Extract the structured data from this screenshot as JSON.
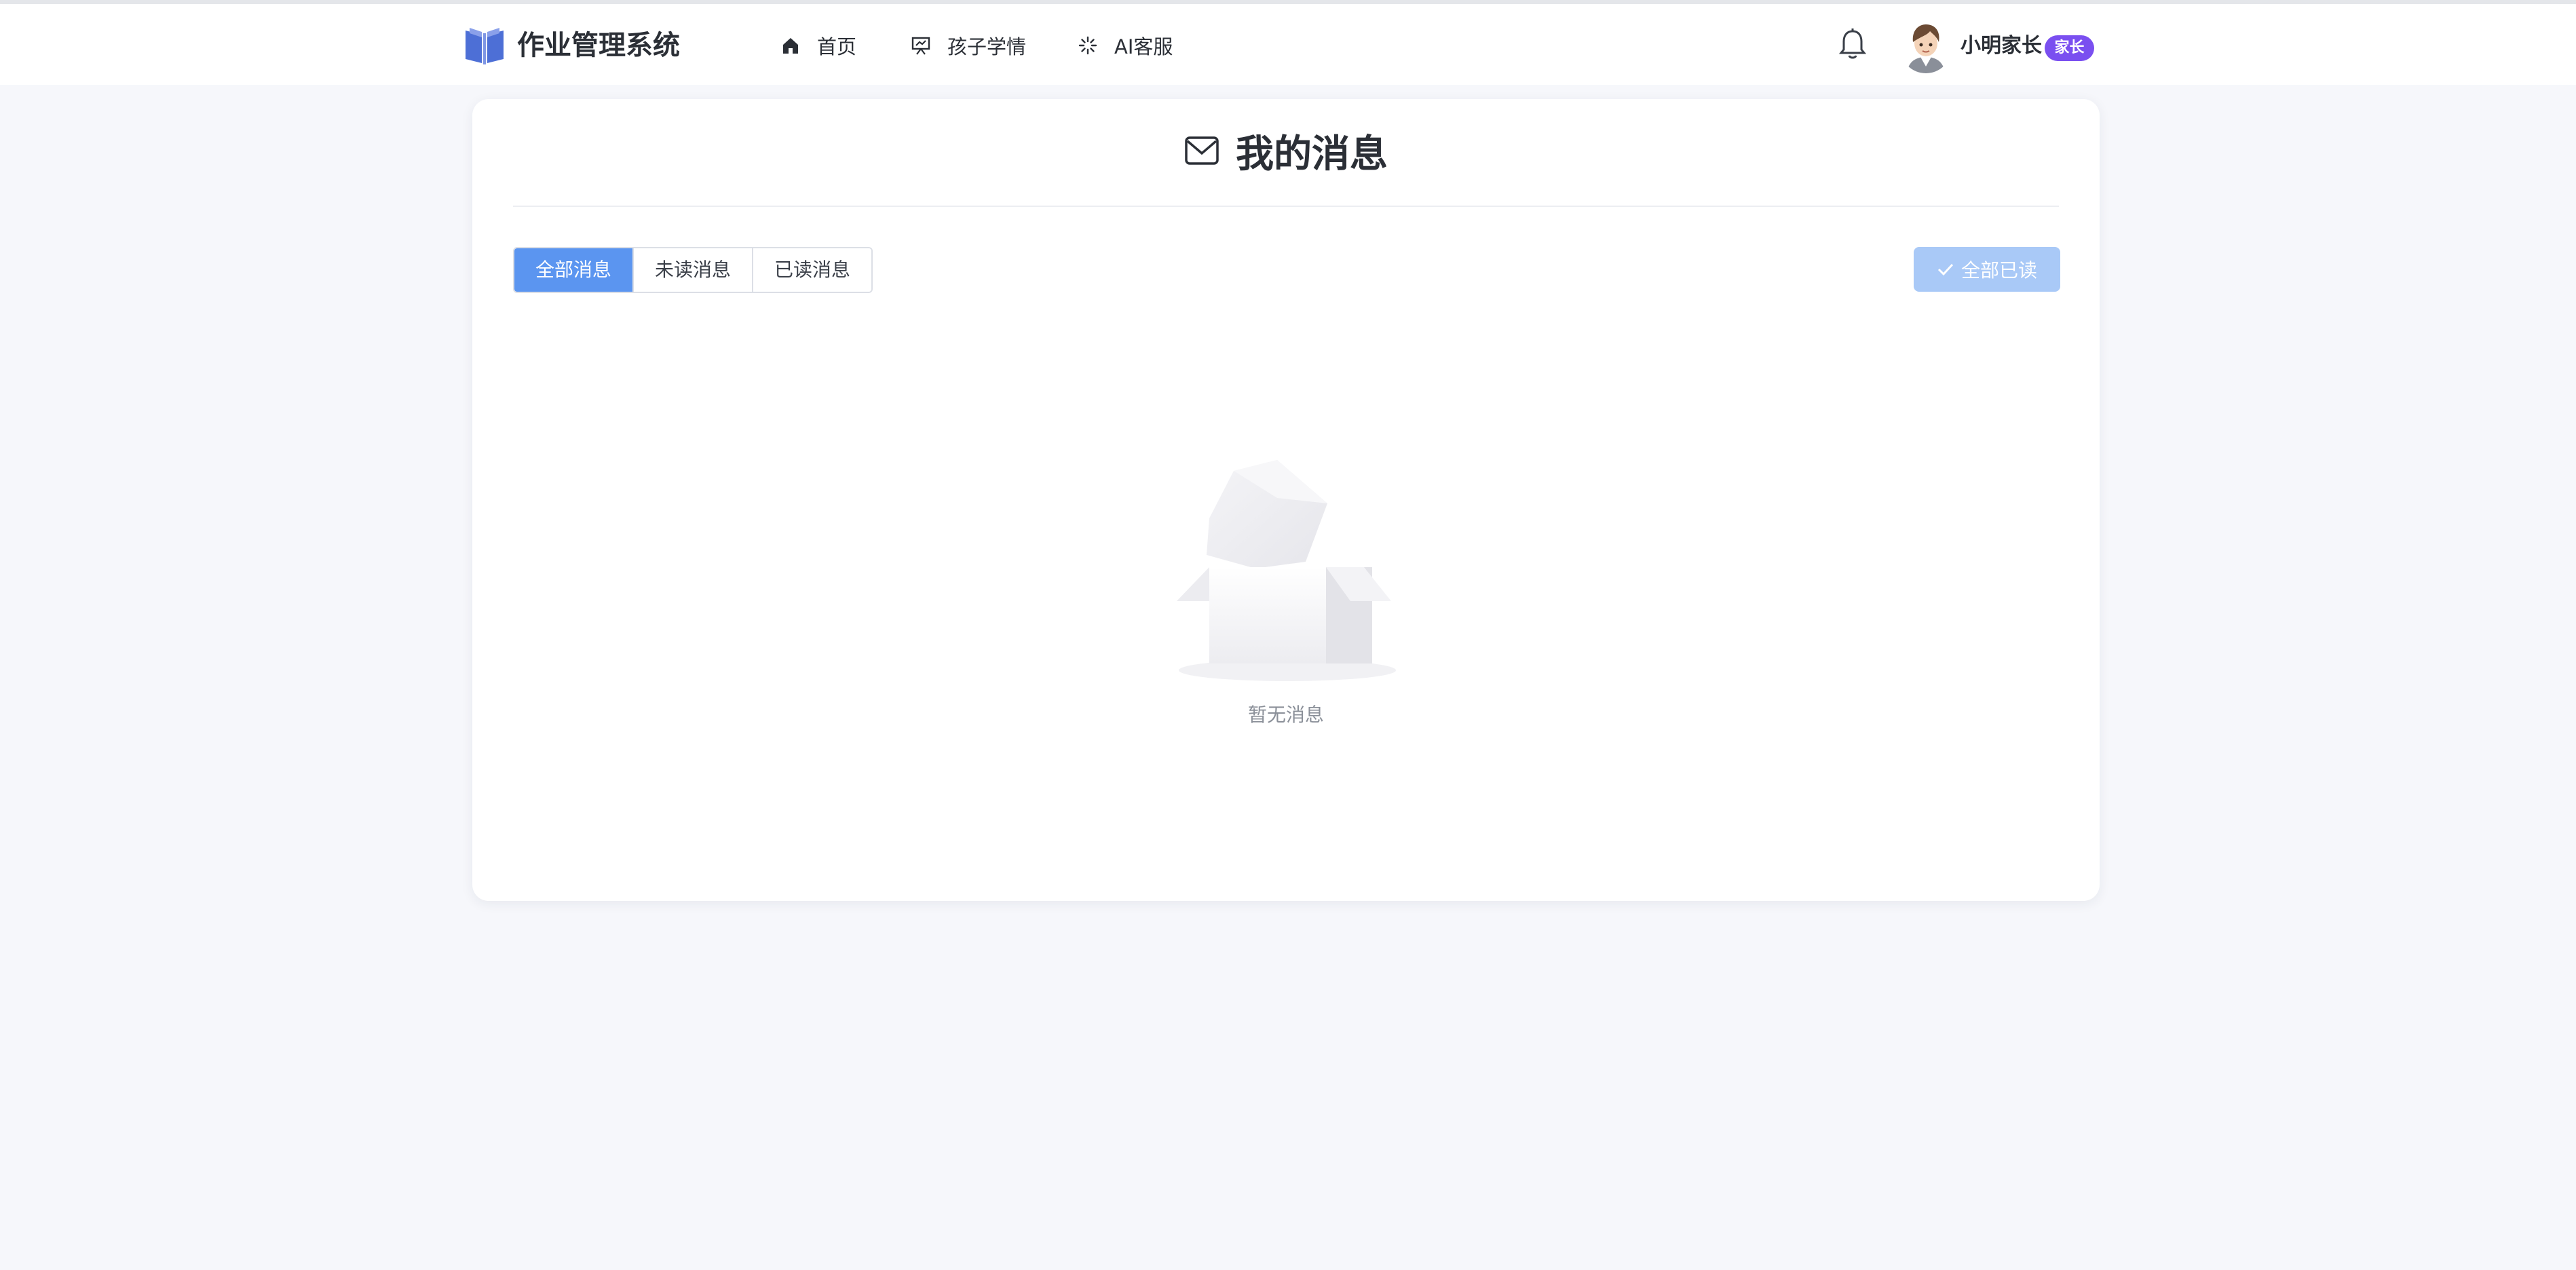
{
  "header": {
    "brand": "作业管理系统",
    "nav": [
      {
        "label": "首页",
        "icon": "home-icon"
      },
      {
        "label": "孩子学情",
        "icon": "presentation-icon"
      },
      {
        "label": "AI客服",
        "icon": "loading-icon"
      }
    ],
    "user": {
      "name": "小明家长",
      "role": "家长"
    }
  },
  "main": {
    "title": "我的消息",
    "tabs": [
      {
        "label": "全部消息",
        "active": true
      },
      {
        "label": "未读消息",
        "active": false
      },
      {
        "label": "已读消息",
        "active": false
      }
    ],
    "mark_all_label": "全部已读",
    "empty_text": "暂无消息"
  },
  "colors": {
    "accent": "#5b95f0",
    "accent_disabled": "#a9c9f7",
    "badge": "#7a4ff0",
    "background": "#f6f7fb"
  }
}
